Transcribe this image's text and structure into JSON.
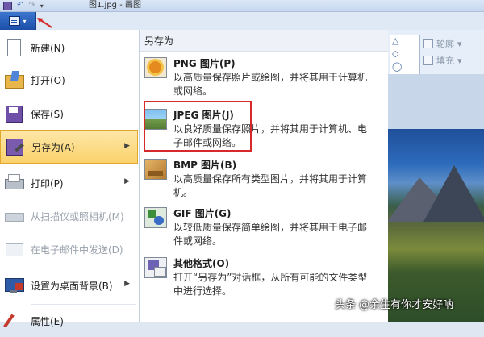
{
  "window": {
    "title": "图1.jpg - 画图"
  },
  "paint_menu_button": {
    "icon": "paint-menu-icon",
    "caret": "▾"
  },
  "left_menu": {
    "items": [
      {
        "label": "新建(N)",
        "icon": "new-document-icon",
        "disabled": false,
        "active": false
      },
      {
        "label": "打开(O)",
        "icon": "open-folder-icon",
        "disabled": false,
        "active": false
      },
      {
        "label": "保存(S)",
        "icon": "save-icon",
        "disabled": false,
        "active": false
      },
      {
        "label": "另存为(A)",
        "icon": "save-as-icon",
        "disabled": false,
        "active": true
      },
      {
        "label": "打印(P)",
        "icon": "printer-icon",
        "disabled": false,
        "active": false
      },
      {
        "label": "从扫描仪或照相机(M)",
        "icon": "scanner-icon",
        "disabled": true,
        "active": false
      },
      {
        "label": "在电子邮件中发送(D)",
        "icon": "email-icon",
        "disabled": true,
        "active": false
      },
      {
        "label": "设置为桌面背景(B)",
        "icon": "desktop-background-icon",
        "disabled": false,
        "active": false
      },
      {
        "label": "属性(E)",
        "icon": "properties-icon",
        "disabled": false,
        "active": false
      }
    ]
  },
  "save_as_submenu": {
    "header": "另存为",
    "formats": [
      {
        "name": "PNG 图片(P)",
        "desc": "以高质量保存照片或绘图，并将其用于计算机或网络。",
        "icon": "png-image-icon"
      },
      {
        "name": "JPEG 图片(J)",
        "desc": "以良好质量保存照片，并将其用于计算机、电子邮件或网络。",
        "icon": "jpeg-image-icon"
      },
      {
        "name": "BMP 图片(B)",
        "desc": "以高质量保存所有类型图片，并将其用于计算机。",
        "icon": "bmp-image-icon"
      },
      {
        "name": "GIF 图片(G)",
        "desc": "以较低质量保存简单绘图，并将其用于电子邮件或网络。",
        "icon": "gif-image-icon"
      },
      {
        "name": "其他格式(O)",
        "desc": "打开“另存为”对话框，从所有可能的文件类型中进行选择。",
        "icon": "other-formats-icon"
      }
    ]
  },
  "ribbon": {
    "outline_label": "轮廓",
    "fill_label": "填充",
    "dropdown_glyph": "▾"
  },
  "watermark": "头条 @余生有你才安好呐",
  "colors": {
    "paint_button": "#1b4fa8",
    "active_item": "#fbd26c",
    "highlight_border": "#d62a2a"
  }
}
